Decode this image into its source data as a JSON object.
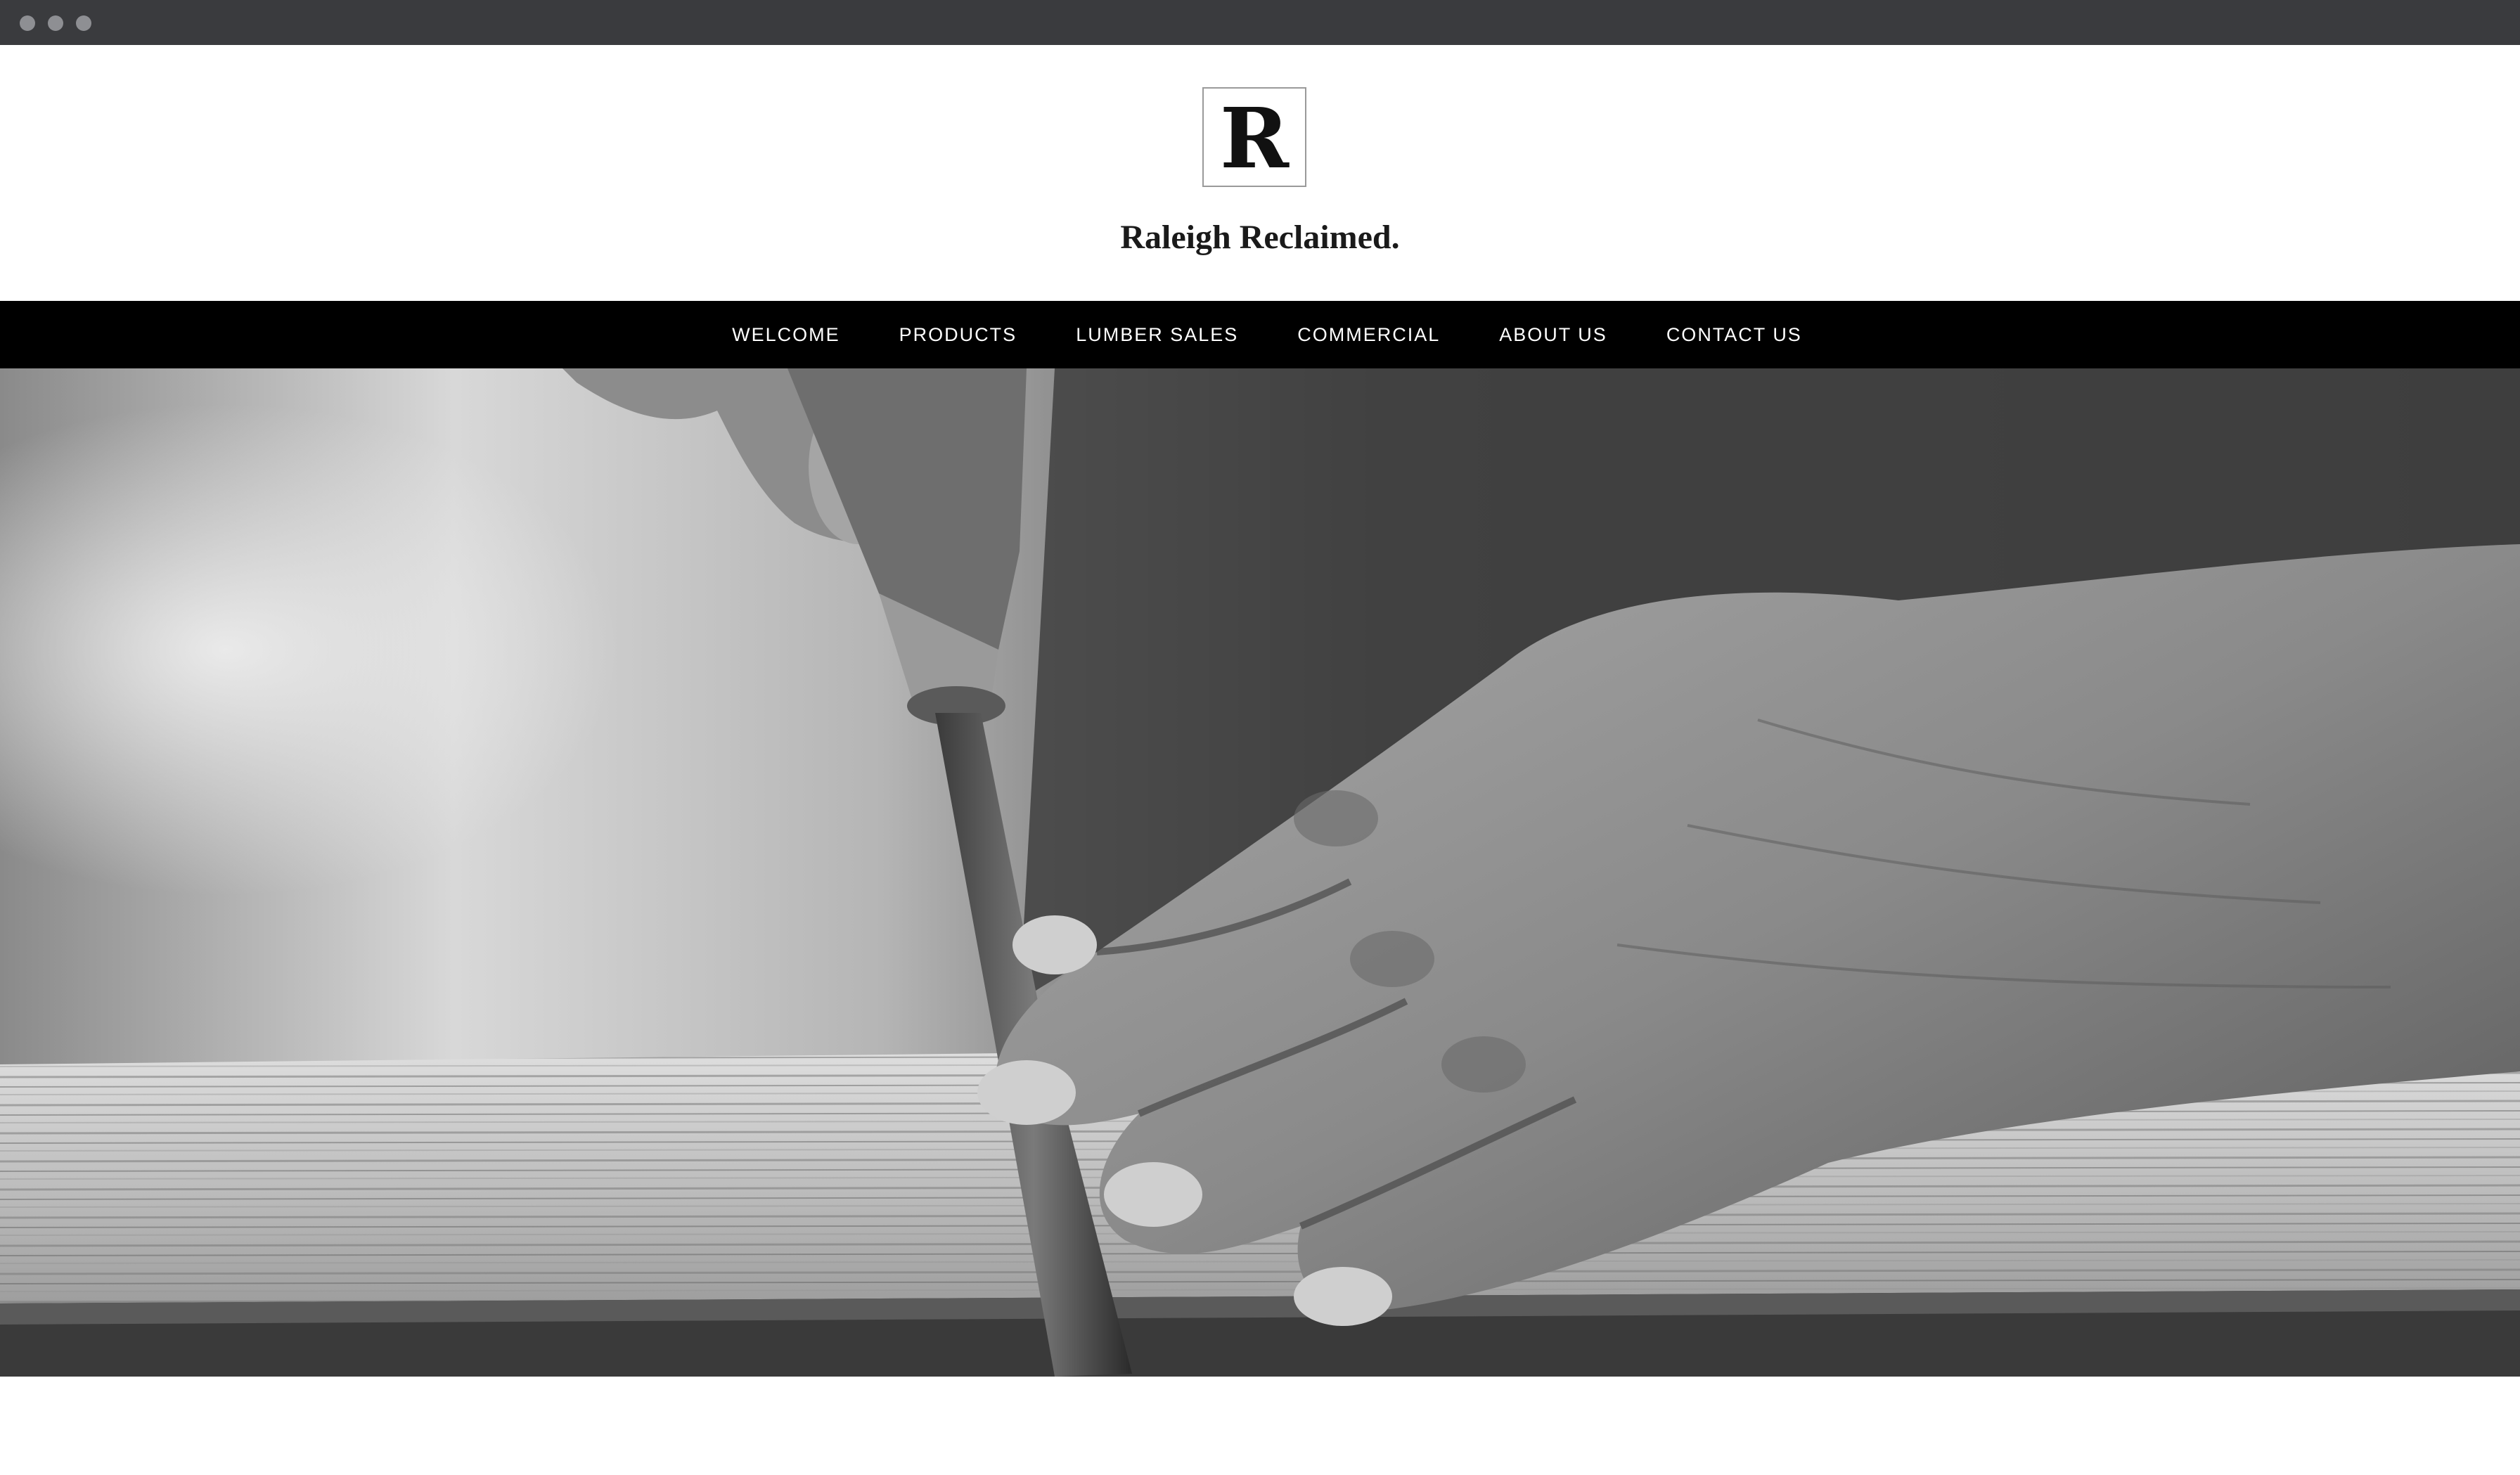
{
  "site": {
    "logo_letter": "R",
    "title": "Raleigh Reclaimed."
  },
  "nav": {
    "items": [
      {
        "label": "WELCOME"
      },
      {
        "label": "PRODUCTS"
      },
      {
        "label": "LUMBER SALES"
      },
      {
        "label": "COMMERCIAL"
      },
      {
        "label": "ABOUT US"
      },
      {
        "label": "CONTACT US"
      }
    ]
  },
  "hero": {
    "icon": "woodworking-hands-photo"
  },
  "colors": {
    "nav_background": "#000000",
    "nav_text": "#ffffff",
    "chrome_bar": "#3a3b3e",
    "title_text": "#1a1a1a"
  }
}
